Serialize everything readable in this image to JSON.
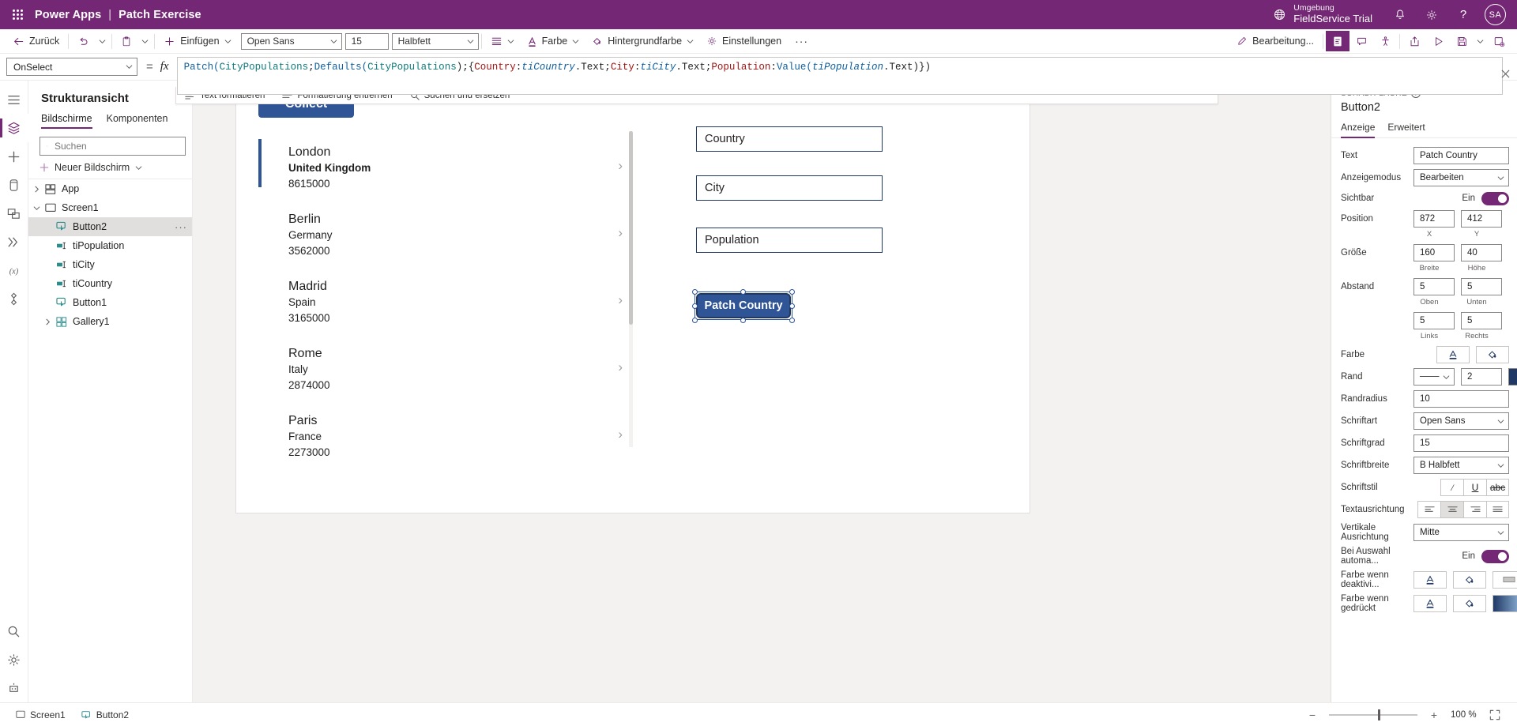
{
  "topbar": {
    "waffle_icon": "app-launcher-icon",
    "product": "Power Apps",
    "separator": "|",
    "app_name": "Patch Exercise",
    "env_label": "Umgebung",
    "env_name": "FieldService Trial",
    "globe_icon": "environment-globe-icon",
    "bell_icon": "notifications-bell-icon",
    "gear_icon": "settings-gear-icon",
    "help_icon": "help-question-icon",
    "avatar_initials": "SA",
    "background": "#742774"
  },
  "commandbar": {
    "back_label": "Zurück",
    "undo_icon": "undo-icon",
    "paste_icon": "paste-icon",
    "insert_label": "Einfügen",
    "font_value": "Open Sans",
    "fontsize_value": "15",
    "fontweight_value": "Halbfett",
    "align_icon": "text-align-icon",
    "color_label": "Farbe",
    "fill_label": "Hintergrundfarbe",
    "settings_label": "Einstellungen",
    "overflow_label": "···",
    "edit_label": "Bearbeitung...",
    "right_icons": [
      "app-checker-icon",
      "comments-icon",
      "accessibility-icon",
      "share-icon",
      "preview-play-icon",
      "save-icon",
      "save-chevron-icon",
      "publish-icon"
    ]
  },
  "formulabar": {
    "property": "OnSelect",
    "equals": "=",
    "fx": "fx",
    "formula": "Patch(CityPopulations;Defaults(CityPopulations);{Country:tiCountry.Text;City:tiCity.Text;Population:Value(tiPopulation.Text)})",
    "tokens": [
      {
        "t": "Patch(",
        "c": "fn"
      },
      {
        "t": "CityPopulations",
        "c": "ds"
      },
      {
        "t": ";",
        "c": "k"
      },
      {
        "t": "Defaults(",
        "c": "fn"
      },
      {
        "t": "CityPopulations",
        "c": "ds"
      },
      {
        "t": ")",
        "c": "k"
      },
      {
        "t": ";{",
        "c": "k"
      },
      {
        "t": "Country",
        "c": "p"
      },
      {
        "t": ":",
        "c": "k"
      },
      {
        "t": "tiCountry",
        "c": "it"
      },
      {
        "t": ".Text",
        "c": "k"
      },
      {
        "t": ";",
        "c": "k"
      },
      {
        "t": "City",
        "c": "p"
      },
      {
        "t": ":",
        "c": "k"
      },
      {
        "t": "tiCity",
        "c": "it"
      },
      {
        "t": ".Text",
        "c": "k"
      },
      {
        "t": ";",
        "c": "k"
      },
      {
        "t": "Population",
        "c": "p"
      },
      {
        "t": ":",
        "c": "k"
      },
      {
        "t": "Value(",
        "c": "fn"
      },
      {
        "t": "tiPopulation",
        "c": "it"
      },
      {
        "t": ".Text",
        "c": "k"
      },
      {
        "t": ")})",
        "c": "k"
      }
    ],
    "close_icon": "close-icon",
    "sub_actions": [
      {
        "label": "Text formatieren",
        "icon": "format-text-icon"
      },
      {
        "label": "Formatierung entfernen",
        "icon": "clear-format-icon"
      },
      {
        "label": "Suchen und ersetzen",
        "icon": "search-replace-icon"
      }
    ]
  },
  "rail": {
    "items": [
      {
        "name": "hamburger-menu-icon",
        "selected": false
      },
      {
        "name": "tree-view-icon",
        "selected": true
      },
      {
        "name": "insert-plus-icon",
        "selected": false
      },
      {
        "name": "data-cylinder-icon",
        "selected": false
      },
      {
        "name": "media-icon",
        "selected": false
      },
      {
        "name": "power-automate-icon",
        "selected": false
      },
      {
        "name": "variables-icon",
        "selected": false
      },
      {
        "name": "components-icon",
        "selected": false
      },
      {
        "name": "search-icon",
        "selected": false
      },
      {
        "name": "settings-gear-icon",
        "selected": false
      },
      {
        "name": "help-bot-icon",
        "selected": false
      }
    ]
  },
  "treeview": {
    "title": "Strukturansicht",
    "tabs": [
      {
        "label": "Bildschirme",
        "selected": true
      },
      {
        "label": "Komponenten",
        "selected": false
      }
    ],
    "search_placeholder": "Suchen",
    "search_value": "",
    "search_icon": "search-icon",
    "new_screen_label": "Neuer Bildschirm",
    "new_screen_icon": "plus-icon",
    "nodes": [
      {
        "label": "App",
        "icon": "app-icon",
        "expander": "collapsed",
        "indent": 1,
        "selected": false
      },
      {
        "label": "Screen1",
        "icon": "screen-icon",
        "expander": "expanded",
        "indent": 1,
        "selected": false
      },
      {
        "label": "Button2",
        "icon": "button-icon",
        "expander": "none",
        "indent": 2,
        "selected": true,
        "overflow": "..."
      },
      {
        "label": "tiPopulation",
        "icon": "textinput-icon",
        "expander": "none",
        "indent": 2,
        "selected": false
      },
      {
        "label": "tiCity",
        "icon": "textinput-icon",
        "expander": "none",
        "indent": 2,
        "selected": false
      },
      {
        "label": "tiCountry",
        "icon": "textinput-icon",
        "expander": "none",
        "indent": 2,
        "selected": false
      },
      {
        "label": "Button1",
        "icon": "button-icon",
        "expander": "none",
        "indent": 2,
        "selected": false
      },
      {
        "label": "Gallery1",
        "icon": "gallery-icon",
        "expander": "collapsed",
        "indent": 2,
        "selected": false
      }
    ]
  },
  "canvas": {
    "collect_button": {
      "label": "Collect",
      "bg": "#2f5596",
      "text_color": "#ffffff"
    },
    "gallery": {
      "items": [
        {
          "city": "London",
          "country": "United Kingdom",
          "population": "8615000",
          "selected": true
        },
        {
          "city": "Berlin",
          "country": "Germany",
          "population": "3562000",
          "selected": false
        },
        {
          "city": "Madrid",
          "country": "Spain",
          "population": "3165000",
          "selected": false
        },
        {
          "city": "Rome",
          "country": "Italy",
          "population": "2874000",
          "selected": false
        },
        {
          "city": "Paris",
          "country": "France",
          "population": "2273000",
          "selected": false
        }
      ],
      "chevron_icon": "chevron-right-icon"
    },
    "inputs": [
      {
        "name": "tiCountry",
        "value": "Country"
      },
      {
        "name": "tiCity",
        "value": "City"
      },
      {
        "name": "tiPopulation",
        "value": "Population"
      }
    ],
    "patch_button": {
      "label": "Patch Country",
      "bg": "#2f5596",
      "border": "#1f3864",
      "selected": true
    }
  },
  "properties": {
    "section_label": "SCHALTFLÄCHE",
    "help_icon": "help-question-icon",
    "control_name": "Button2",
    "tabs": [
      {
        "label": "Anzeige",
        "selected": true
      },
      {
        "label": "Erweitert",
        "selected": false
      }
    ],
    "rows": [
      {
        "label": "Text",
        "type": "text",
        "value": "Patch Country"
      },
      {
        "label": "Anzeigemodus",
        "type": "select",
        "value": "Bearbeiten"
      },
      {
        "label": "Sichtbar",
        "type": "toggle",
        "toggle_label": "Ein",
        "on": true
      },
      {
        "label": "Position",
        "type": "pair",
        "v1": "872",
        "v2": "412",
        "c1": "X",
        "c2": "Y"
      },
      {
        "label": "Größe",
        "type": "pair",
        "v1": "160",
        "v2": "40",
        "c1": "Breite",
        "c2": "Höhe"
      },
      {
        "label": "Abstand",
        "type": "pair",
        "v1": "5",
        "v2": "5",
        "c1": "Oben",
        "c2": "Unten"
      },
      {
        "label": "",
        "type": "pair",
        "v1": "5",
        "v2": "5",
        "c1": "Links",
        "c2": "Rechts"
      },
      {
        "label": "Farbe",
        "type": "colorbuttons",
        "icon1": "font-color-icon",
        "icon2": "fill-color-icon"
      },
      {
        "label": "Rand",
        "type": "border",
        "style": "───",
        "width": "2",
        "color": "#1f3864"
      },
      {
        "label": "Randradius",
        "type": "text",
        "value": "10"
      },
      {
        "label": "Schriftart",
        "type": "select",
        "value": "Open Sans"
      },
      {
        "label": "Schriftgrad",
        "type": "text",
        "value": "15"
      },
      {
        "label": "Schriftbreite",
        "type": "select",
        "value": "Halbfett",
        "prefix": "B"
      },
      {
        "label": "Schriftstil",
        "type": "icons",
        "icons": [
          "italic-icon",
          "underline-icon",
          "strikethrough-icon"
        ]
      },
      {
        "label": "Textausrichtung",
        "type": "icons",
        "icons": [
          "align-left-icon",
          "align-center-icon",
          "align-right-icon",
          "align-justify-icon"
        ],
        "selected_index": 1
      },
      {
        "label": "Vertikale Ausrichtung",
        "type": "select",
        "value": "Mitte"
      },
      {
        "label": "Bei Auswahl automa...",
        "type": "toggle",
        "toggle_label": "Ein",
        "on": true
      },
      {
        "label": "Farbe wenn deaktivi...",
        "type": "colorbuttons",
        "icon1": "font-color-icon",
        "icon2": "fill-color-icon",
        "icon3": "border-color-icon"
      },
      {
        "label": "Farbe wenn gedrückt",
        "type": "colorbuttons",
        "icon1": "font-color-icon",
        "icon2": "fill-color-icon",
        "icon3": "gradient-icon"
      }
    ]
  },
  "bottombar": {
    "screen_chip": {
      "label": "Screen1",
      "icon": "screen-icon"
    },
    "control_chip": {
      "label": "Button2",
      "icon": "button-icon"
    },
    "zoom_out_icon": "minus-icon",
    "zoom_in_icon": "plus-icon",
    "zoom_value": "100 %",
    "expand_icon": "fit-screen-icon"
  }
}
